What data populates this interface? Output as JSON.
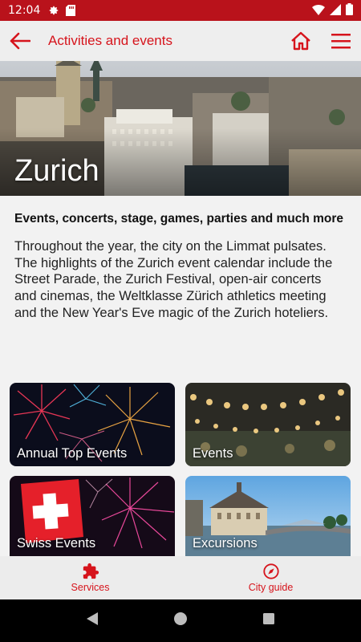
{
  "status_bar": {
    "time": "12:04"
  },
  "app_bar": {
    "title": "Activities and events"
  },
  "hero": {
    "title": "Zurich"
  },
  "intro": {
    "subtitle": "Events, concerts, stage, games, parties and much more",
    "body": "Throughout the year, the city on the Limmat pulsates. The highlights of the Zurich event calendar include the Street Parade, the Zurich Festival, open-air concerts and cinemas, the Weltklasse Zürich athletics meeting and the New Year's Eve magic of the Zurich hoteliers."
  },
  "tiles": [
    {
      "label": "Annual Top Events"
    },
    {
      "label": "Events"
    },
    {
      "label": "Swiss Events"
    },
    {
      "label": "Excursions"
    }
  ],
  "bottom_nav": [
    {
      "label": "Services"
    },
    {
      "label": "City guide"
    }
  ],
  "colors": {
    "accent": "#d6141c",
    "status_bar": "#b9121b"
  }
}
